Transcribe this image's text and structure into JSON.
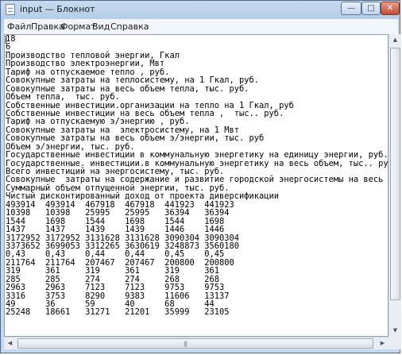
{
  "window": {
    "title": "input — Блокнот",
    "minimize_glyph": "—",
    "maximize_glyph": "□",
    "close_glyph": "✕"
  },
  "menu": {
    "file": "Файл",
    "edit": "Правка",
    "format": "Формат",
    "view": "Вид",
    "help": "Справка"
  },
  "document": {
    "lines": [
      "18",
      "6",
      "Производство тепловой энергии, Гкал",
      "Производство электроэнергии, Мвт",
      "Тариф на отпускаемое тепло , руб.",
      "Совокупные затраты на теплосистему, на 1 Гкал, руб.",
      "Совокупные затраты на весь объем тепла, тыс. руб.",
      "Объем тепла,  тыс. руб.",
      "Собственные инвестиции.организации на тепло на 1 Гкал, руб",
      "Собственные инвестиции на весь объем тепла ,  тыс.. руб.",
      "Тариф на отпускаемую э/энергию , руб.",
      "Совокупные затраты на  электросистему, на 1 Мвт",
      "Совокупные затраты на весь объем э/энергии, тыс. руб",
      "Объем э/энергии, тыс. руб.",
      "Государственные инвестиции в коммунальную энергетику на единицу энергии, руб.",
      "Государственные. инвестиции.в коммунальную энергетику на весь объем, тыс.. руб.",
      "Всего инвестиций на энергосистему, тыс. руб.",
      "Совокупные  затраты на содержание и развитие городской энергосистемы на весь объем энер",
      "Суммарный объем отпущенной энергии, тыс. руб.",
      "Чистый дисконтированный доход от проекта диверсификации",
      "493914  493914  467918  467918  441923  441923",
      "10398   10398   25995   25995   36394   36394",
      "1544    1698    1544    1698    1544    1698",
      "1437    1437    1439    1439    1446    1446",
      "3172952 3172952 3131628 3131628 3090304 3090304",
      "3373652 3699053 3312265 3630619 3248873 3560180",
      "0,43    0,43    0,44    0,44    0,45    0,45",
      "211764  211764  207467  207467  200800  200800",
      "319     361     319     361     319     361",
      "285     285     274     274     268     268",
      "2963    2963    7123    7123    9753    9753",
      "3316    3753    8290    9383    11606   13137",
      "49      36      59      40      68      44",
      "25248   18661   31271   21201   35999   23105"
    ]
  },
  "scrollbar": {
    "up_glyph": "▲",
    "down_glyph": "▼",
    "left_glyph": "◀",
    "right_glyph": "▶",
    "grip_glyph": "|||"
  }
}
